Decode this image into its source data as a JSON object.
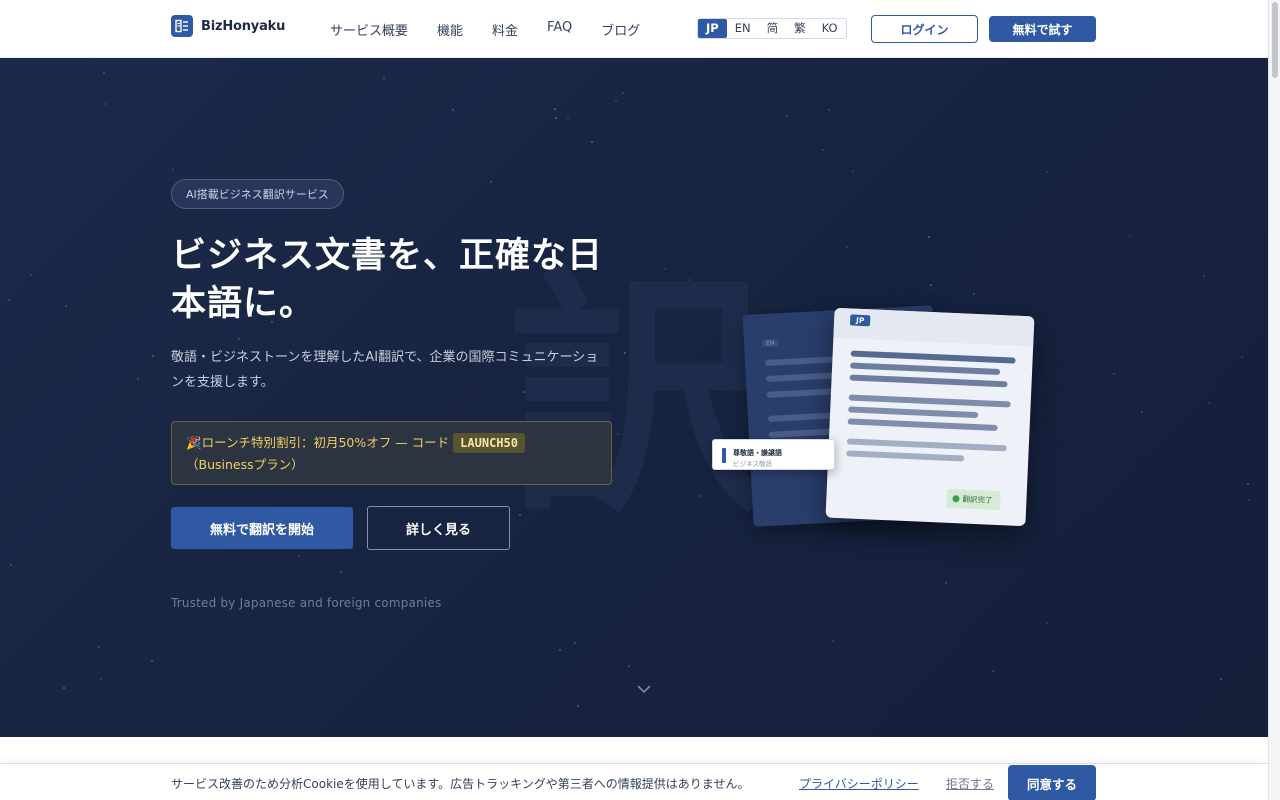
{
  "brand": {
    "name": "BizHonyaku",
    "logo_icon": "document-translate-icon"
  },
  "nav": {
    "items": [
      "サービス概要",
      "機能",
      "料金",
      "FAQ",
      "ブログ"
    ]
  },
  "language_switcher": {
    "options": [
      "JP",
      "EN",
      "简",
      "繁",
      "KO"
    ],
    "selected": "JP"
  },
  "header_actions": {
    "login_label": "ログイン",
    "trial_label": "無料で試す"
  },
  "hero": {
    "badge": "AI搭載ビジネス翻訳サービス",
    "title": "ビジネス文書を、正確な日本語に。",
    "description": "敬語・ビジネストーンを理解したAI翻訳で、企業の国際コミュニケーションを支援します。",
    "promo": {
      "icon": "party-popper-icon",
      "text_before": "ローンチ特別割引：初月50%オフ — コード",
      "code": "LAUNCH50",
      "text_after": "（Businessプラン）"
    },
    "primary_cta": "無料で翻訳を開始",
    "secondary_cta": "詳しく見る",
    "trusted": "Trusted by Japanese and foreign companies",
    "background_glyph": "訳",
    "scroll_icon": "chevron-down-icon"
  },
  "illustration": {
    "source_tag": "EN",
    "target_tag": "JP",
    "tooltip_title": "尊敬語・謙譲語",
    "tooltip_subtitle": "ビジネス敬語",
    "status": "翻訳完了"
  },
  "cookie_banner": {
    "message": "サービス改善のため分析Cookieを使用しています。広告トラッキングや第三者への情報提供はありません。",
    "privacy_link": "プライバシーポリシー",
    "reject_label": "拒否する",
    "accept_label": "同意する"
  },
  "colors": {
    "brand_blue": "#2f5aa3",
    "hero_bg": "#172441",
    "promo_text": "#f0cf62"
  }
}
